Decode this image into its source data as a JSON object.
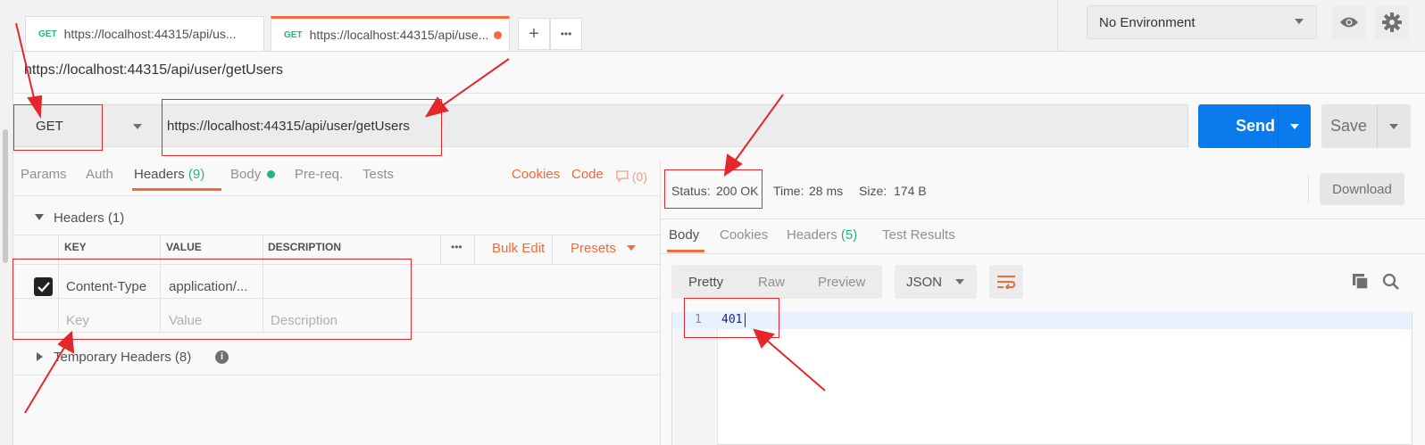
{
  "tabs": [
    {
      "method": "GET",
      "url": "https://localhost:44315/api/us..."
    },
    {
      "method": "GET",
      "url": "https://localhost:44315/api/use..."
    }
  ],
  "tab_actions": {
    "add": "+",
    "more": "•••"
  },
  "environment": {
    "selected": "No Environment"
  },
  "request": {
    "name": "https://localhost:44315/api/user/getUsers",
    "method": "GET",
    "url": "https://localhost:44315/api/user/getUsers",
    "send_label": "Send",
    "save_label": "Save"
  },
  "request_tabs": {
    "params": "Params",
    "auth": "Auth",
    "headers": "Headers",
    "headers_count": "(9)",
    "body": "Body",
    "prereq": "Pre-req.",
    "tests": "Tests",
    "cookies": "Cookies",
    "code": "Code",
    "comments_count": "(0)"
  },
  "headers_section": {
    "title": "Headers",
    "count": "(1)",
    "columns": [
      "KEY",
      "VALUE",
      "DESCRIPTION"
    ],
    "more": "•••",
    "bulk_edit": "Bulk Edit",
    "presets": "Presets",
    "rows": [
      {
        "key": "Content-Type",
        "value": "application/...",
        "checked": true
      }
    ],
    "placeholder": {
      "key": "Key",
      "value": "Value",
      "description": "Description"
    }
  },
  "temporary_headers": {
    "title": "Temporary Headers",
    "count": "(8)"
  },
  "response": {
    "status_label": "Status:",
    "status_value": "200 OK",
    "time_label": "Time:",
    "time_value": "28 ms",
    "size_label": "Size:",
    "size_value": "174 B",
    "download": "Download",
    "tabs": {
      "body": "Body",
      "cookies": "Cookies",
      "headers": "Headers",
      "headers_count": "(5)",
      "test_results": "Test Results"
    },
    "view_modes": [
      "Pretty",
      "Raw",
      "Preview"
    ],
    "format": "JSON",
    "lines": [
      {
        "number": "1",
        "content": "401"
      }
    ]
  },
  "colors": {
    "accent": "#f26b3a",
    "send": "#097bed",
    "success": "#26b47f",
    "annotation": "#e5262b"
  }
}
